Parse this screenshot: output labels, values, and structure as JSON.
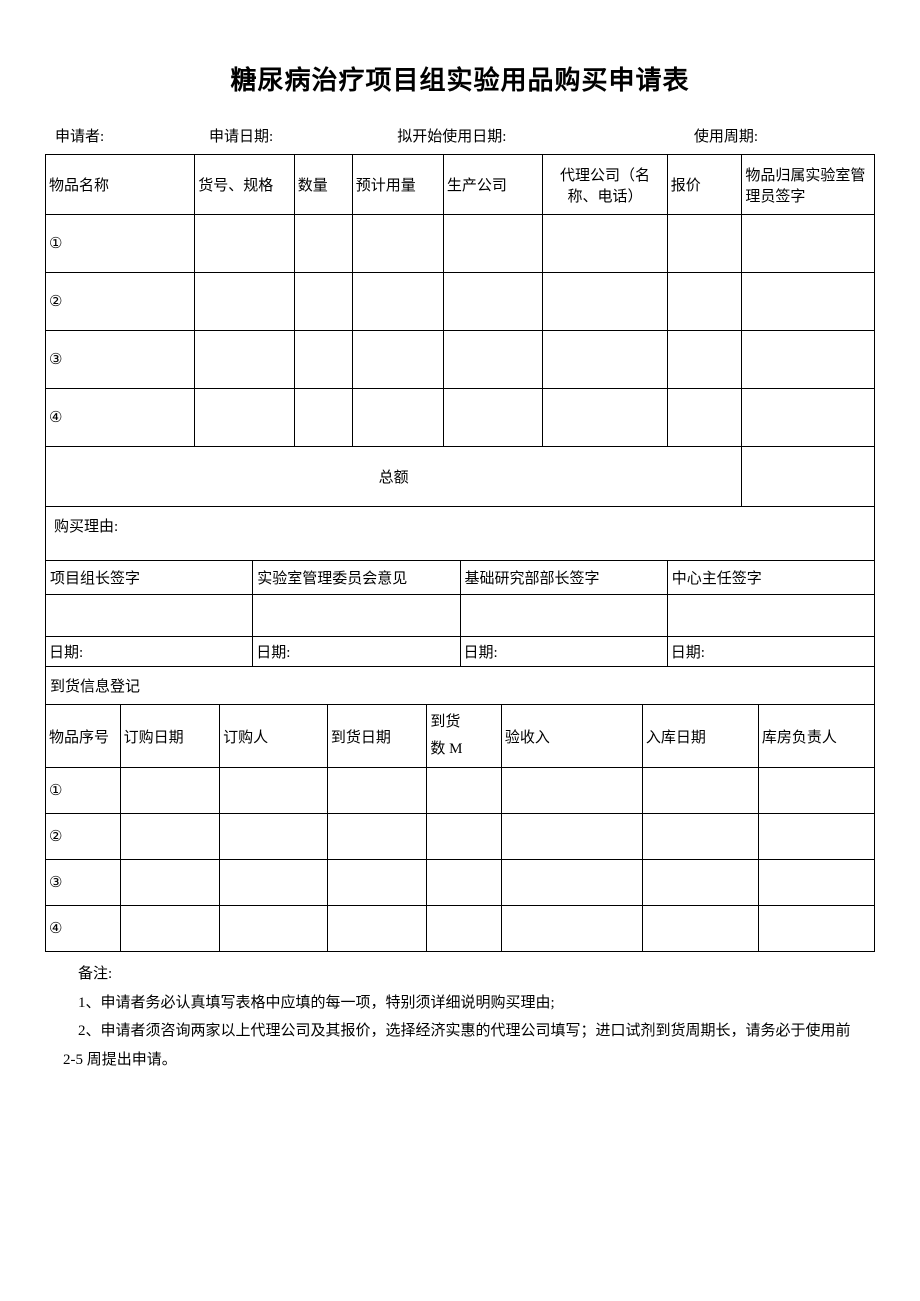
{
  "title": "糖尿病治疗项目组实验用品购买申请表",
  "info": {
    "applicant": "申请者:",
    "apply_date": "申请日期:",
    "start_date": "拟开始使用日期:",
    "cycle": "使用周期:"
  },
  "items_header": {
    "name": "物品名称",
    "spec": "货号、规格",
    "qty": "数量",
    "est": "预计用量",
    "mfr": "生产公司",
    "agent": "代理公司（名称、电话）",
    "quote": "报价",
    "sign": "物品归属实验室管理员签字"
  },
  "rows": [
    "①",
    "②",
    "③",
    "④"
  ],
  "total": "总额",
  "reason_label": "购买理由:",
  "signatures": {
    "leader": "项目组长签字",
    "committee": "实验室管理委员会意见",
    "dept": "基础研究部部长签字",
    "director": "中心主任签字",
    "date": "日期:"
  },
  "arrival_section": "到货信息登记",
  "arrival_header": {
    "seq": "物品序号",
    "order_date": "订购日期",
    "orderer": "订购人",
    "arrive_date": "到货日期",
    "arrive_qty_l1": "到货",
    "arrive_qty_l2": "数 M",
    "inspector": "验收入",
    "stock_date": "入库日期",
    "keeper": "库房负责人"
  },
  "notes_title": "备注:",
  "note1": "1、申请者务必认真填写表格中应填的每一项，特别须详细说明购买理由;",
  "note2": "2、申请者须咨询两家以上代理公司及其报价，选择经济实惠的代理公司填写；进口试剂到货周期长，请务必于使用前2-5 周提出申请。"
}
